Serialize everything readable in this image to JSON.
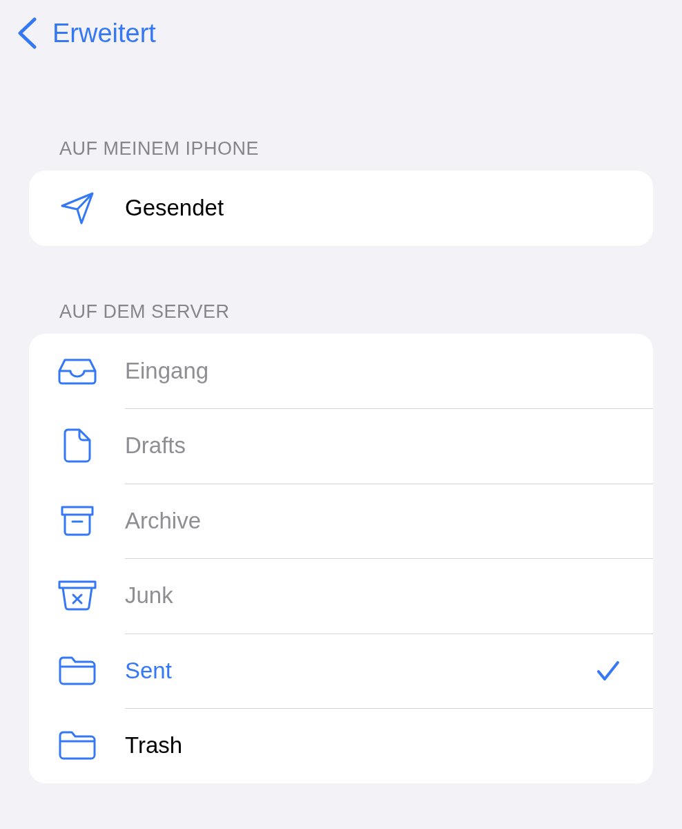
{
  "nav": {
    "back_label": "Erweitert"
  },
  "sections": [
    {
      "header": "AUF MEINEM IPHONE",
      "items": [
        {
          "label": "Gesendet",
          "kind": "send",
          "disabled": false,
          "selected": false
        }
      ]
    },
    {
      "header": "AUF DEM SERVER",
      "items": [
        {
          "label": "Eingang",
          "kind": "inbox",
          "disabled": true,
          "selected": false
        },
        {
          "label": "Drafts",
          "kind": "drafts",
          "disabled": true,
          "selected": false
        },
        {
          "label": "Archive",
          "kind": "archive",
          "disabled": true,
          "selected": false
        },
        {
          "label": "Junk",
          "kind": "junk",
          "disabled": true,
          "selected": false
        },
        {
          "label": "Sent",
          "kind": "folder",
          "disabled": false,
          "selected": true
        },
        {
          "label": "Trash",
          "kind": "folder",
          "disabled": false,
          "selected": false
        }
      ]
    }
  ]
}
